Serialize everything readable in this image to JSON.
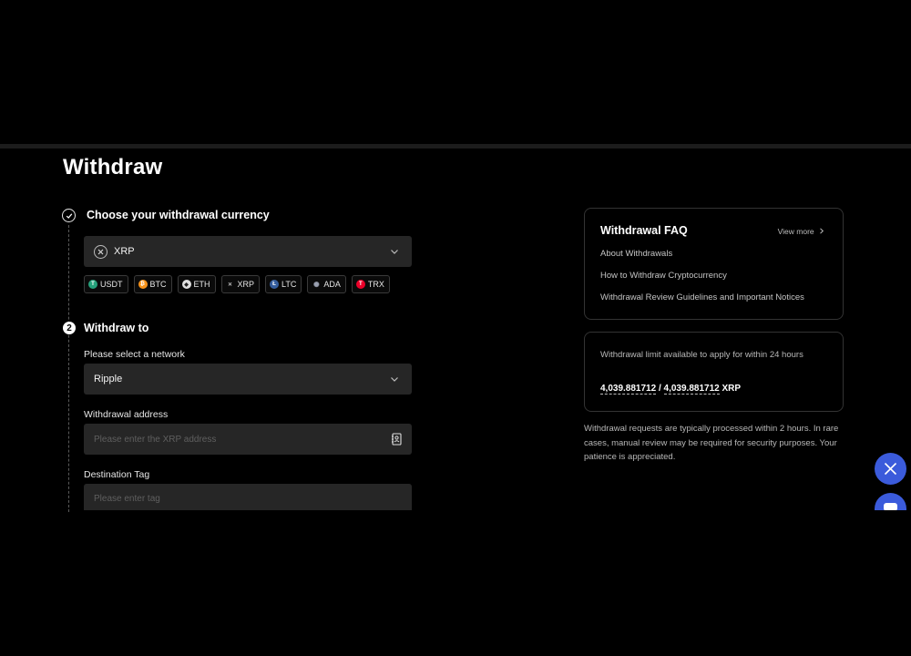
{
  "page": {
    "title": "Withdraw"
  },
  "step1": {
    "number": "1",
    "title": "Choose your withdrawal currency",
    "selected_currency": "XRP",
    "quick_currencies": [
      {
        "symbol": "USDT",
        "color": "#26a17b",
        "glyph": "T"
      },
      {
        "symbol": "BTC",
        "color": "#f7931a",
        "glyph": "₿"
      },
      {
        "symbol": "ETH",
        "color": "#e0e0e0",
        "glyph": "◆"
      },
      {
        "symbol": "XRP",
        "color": "transparent",
        "glyph": "✕"
      },
      {
        "symbol": "LTC",
        "color": "#345d9d",
        "glyph": "Ł"
      },
      {
        "symbol": "ADA",
        "color": "transparent",
        "glyph": "✺"
      },
      {
        "symbol": "TRX",
        "color": "#eb0029",
        "glyph": "T"
      }
    ]
  },
  "step2": {
    "number": "2",
    "title": "Withdraw to",
    "network_label": "Please select a network",
    "network_value": "Ripple",
    "address_label": "Withdrawal address",
    "address_placeholder": "Please enter the XRP address",
    "tag_label": "Destination Tag",
    "tag_placeholder": "Please enter tag"
  },
  "faq": {
    "title": "Withdrawal FAQ",
    "view_more": "View more",
    "links": [
      "About Withdrawals",
      "How to Withdraw Cryptocurrency",
      "Withdrawal Review Guidelines and Important Notices"
    ]
  },
  "limit": {
    "description": "Withdrawal limit available to apply for within 24 hours",
    "available": "4,039.881712",
    "separator": "/",
    "total": "4,039.881712",
    "unit": "XRP"
  },
  "note": "Withdrawal requests are typically processed within 2 hours. In rare cases, manual review may be required for security purposes. Your patience is appreciated.",
  "colors": {
    "background": "#000000",
    "field": "#262626",
    "fab": "#3b5bdb"
  },
  "icons": {
    "step1": "check-circle-icon",
    "currency": "xrp-icon",
    "address_book": "address-book-icon",
    "social": "x-logo-icon",
    "support": "chat-icon"
  }
}
